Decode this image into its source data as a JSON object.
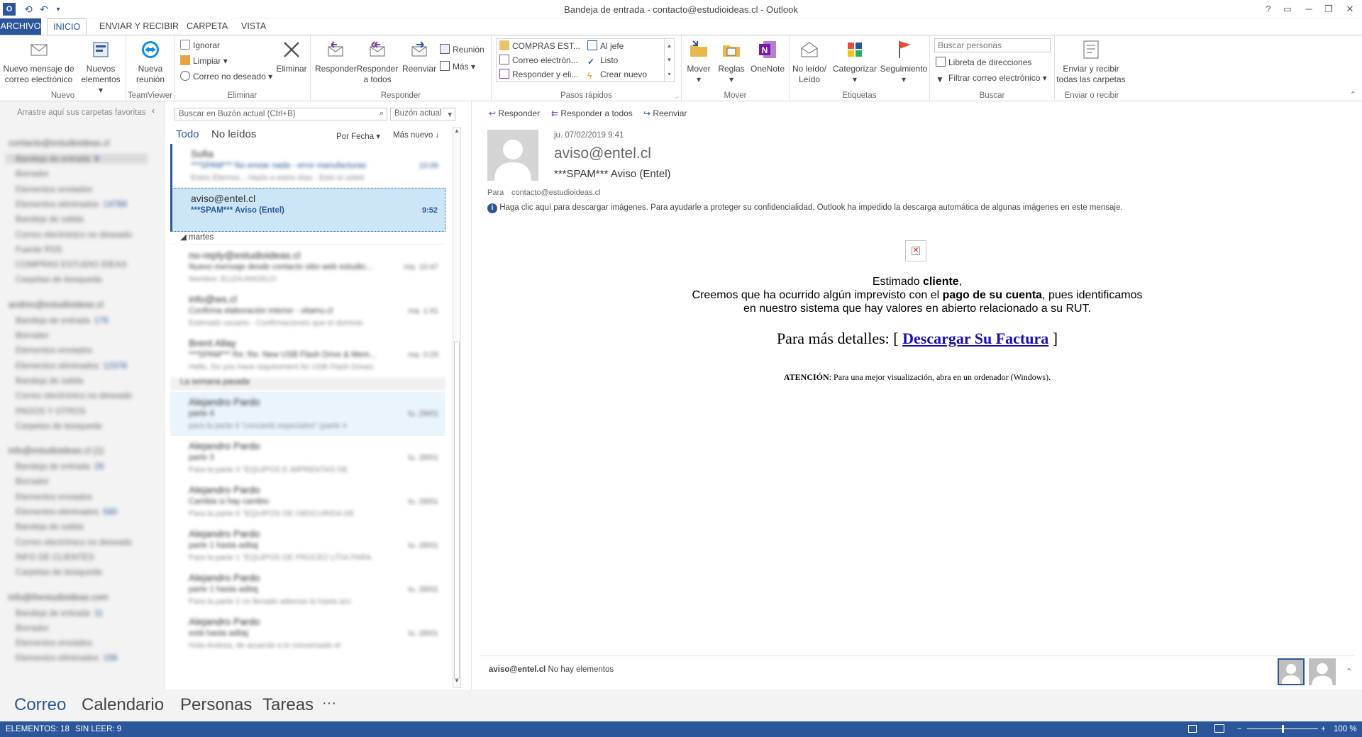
{
  "window": {
    "title": "Bandeja de entrada - contacto@estudioideas.cl - Outlook",
    "help": "?",
    "restore": "▭",
    "minimize": "─",
    "maximize": "❐",
    "close": "✕"
  },
  "ribbon_tabs": [
    "ARCHIVO",
    "INICIO",
    "ENVIAR Y RECIBIR",
    "CARPETA",
    "VISTA"
  ],
  "ribbon": {
    "nuevo": {
      "group": "Nuevo",
      "new_mail_1": "Nuevo mensaje de",
      "new_mail_2": "correo electrónico",
      "new_items_1": "Nuevos",
      "new_items_2": "elementos"
    },
    "teamviewer": {
      "group": "TeamViewer",
      "meeting_1": "Nueva",
      "meeting_2": "reunión"
    },
    "eliminar": {
      "group": "Eliminar",
      "ignore": "Ignorar",
      "clean": "Limpiar",
      "junk": "Correo no deseado",
      "delete": "Eliminar"
    },
    "responder": {
      "group": "Responder",
      "reply": "Responder",
      "reply_all_1": "Responder",
      "reply_all_2": "a todos",
      "forward": "Reenviar",
      "meeting": "Reunión",
      "more": "Más"
    },
    "pasos": {
      "group": "Pasos rápidos",
      "items": [
        "COMPRAS EST...",
        "Correo electrón...",
        "Responder y eli...",
        "Al jefe",
        "Listo",
        "Crear nuevo"
      ]
    },
    "mover": {
      "group": "Mover",
      "move": "Mover",
      "rules": "Reglas",
      "onenote": "OneNote"
    },
    "etiquetas": {
      "group": "Etiquetas",
      "unread_1": "No leído/",
      "unread_2": "Leído",
      "categorize": "Categorizar",
      "followup": "Seguimiento"
    },
    "buscar": {
      "group": "Buscar",
      "people_placeholder": "Buscar personas",
      "address_book": "Libreta de direcciones",
      "filter": "Filtrar correo electrónico"
    },
    "enviar": {
      "group": "Enviar o recibir",
      "sendall_1": "Enviar y recibir",
      "sendall_2": "todas las carpetas"
    }
  },
  "folders": {
    "favorites_hint": "Arrastre aquí sus carpetas favoritas",
    "accounts": [
      {
        "name": "contacto@estudioideas.cl",
        "items": [
          {
            "n": "Bandeja de entrada",
            "c": "9"
          },
          {
            "n": "Borrador",
            "c": ""
          },
          {
            "n": "Elementos enviados",
            "c": ""
          },
          {
            "n": "Elementos eliminados",
            "c": "14789"
          },
          {
            "n": "Bandeja de salida",
            "c": ""
          },
          {
            "n": "Correo electrónico no deseado",
            "c": ""
          },
          {
            "n": "Fuente RSS",
            "c": ""
          },
          {
            "n": "COMPRAS ESTUDIO IDEAS",
            "c": ""
          },
          {
            "n": "Carpetas de búsqueda",
            "c": ""
          }
        ]
      },
      {
        "name": "andres@estudioideas.cl",
        "items": [
          {
            "n": "Bandeja de entrada",
            "c": "176"
          },
          {
            "n": "Borrador",
            "c": ""
          },
          {
            "n": "Elementos enviados",
            "c": ""
          },
          {
            "n": "Elementos eliminados",
            "c": "12378"
          },
          {
            "n": "Bandeja de salida",
            "c": ""
          },
          {
            "n": "Correo electrónico no deseado",
            "c": ""
          },
          {
            "n": "PAGOS Y OTROS",
            "c": ""
          },
          {
            "n": "Carpetas de búsqueda",
            "c": ""
          }
        ]
      },
      {
        "name": "info@estudioideas.cl (1)",
        "items": [
          {
            "n": "Bandeja de entrada",
            "c": "29"
          },
          {
            "n": "Borrador",
            "c": ""
          },
          {
            "n": "Elementos enviados",
            "c": ""
          },
          {
            "n": "Elementos eliminados",
            "c": "580"
          },
          {
            "n": "Bandeja de salida",
            "c": ""
          },
          {
            "n": "Correo electrónico no deseado",
            "c": ""
          },
          {
            "n": "INFO DE CLIENTES",
            "c": ""
          },
          {
            "n": "Carpetas de búsqueda",
            "c": ""
          }
        ]
      },
      {
        "name": "info@thestudioideas.com",
        "items": [
          {
            "n": "Bandeja de entrada",
            "c": "11"
          },
          {
            "n": "Borrador",
            "c": ""
          },
          {
            "n": "Elementos enviados",
            "c": ""
          },
          {
            "n": "Elementos eliminados",
            "c": "158"
          }
        ]
      }
    ]
  },
  "list": {
    "search_placeholder": "Buscar en Buzón actual (Ctrl+B)",
    "scope": "Buzón actual",
    "filter_all": "Todo",
    "filter_unread": "No leídos",
    "sort": "Por Fecha",
    "order": "Más nuevo",
    "group_tuesday": "martes",
    "group_lastweek": "La semana pasada",
    "messages": [
      {
        "from": "Sofia",
        "subject": "***SPAM*** No enviar nada - error manufacturas",
        "preview": "Estos Eternos... Hazlo a estos días - Esto si usted",
        "time": "10:06"
      },
      {
        "from": "aviso@entel.cl",
        "subject": "***SPAM***  Aviso (Entel)",
        "preview": "",
        "time": "9:52"
      },
      {
        "from": "no-reply@estudioideas.cl",
        "subject": "Nuevo mensaje desde contacto sitio web estudio...",
        "preview": "Nombre: ELIZA ANGELO",
        "time": "ma. 10:47"
      },
      {
        "from": "info@ws.cl",
        "subject": "Confirma elaboración interior - vitamu.cl",
        "preview": "Estimado usuario - Confirmaciones que el dominio",
        "time": "ma. 1:41"
      },
      {
        "from": "Brent Allay",
        "subject": "***SPAM*** Re: Re: New USB Flash Drive & Mem...",
        "preview": "Hello, Do you have requirement for USB Flash Drives",
        "time": "ma. 0:29"
      },
      {
        "from": "Alejandro Pardo",
        "subject": "parte 4",
        "preview": "para la parte 4 \"concierto especiales\" (parte 4",
        "time": "lu. 29/01"
      },
      {
        "from": "Alejandro Pardo",
        "subject": "parte 3",
        "preview": "Para la parte 3 \"EQUIPOS E IMPRENTAS DE",
        "time": "lu. 28/01"
      },
      {
        "from": "Alejandro Pardo",
        "subject": "Cambia si hay cambio",
        "preview": "Para la parte 6 \"EQUIPOS DE OBSCURIDA DE",
        "time": "lu. 28/01"
      },
      {
        "from": "Alejandro Pardo",
        "subject": "parte 1 hasta aditaj",
        "preview": "Para la parte 1 \"EQUIPOS DE PROCEZ LÍTIA PARA",
        "time": "lu. 28/01"
      },
      {
        "from": "Alejandro Pardo",
        "subject": "parte 1 hasta aditaj",
        "preview": "Para la parte 2 co llenado ademas la hasta acc",
        "time": "lu. 28/01"
      },
      {
        "from": "Alejandro Pardo",
        "subject": "está hasta aditaj",
        "preview": "Hola Andrea, de acuerdo a lo conversado el",
        "time": "lu. 28/01"
      }
    ]
  },
  "reading": {
    "reply": "Responder",
    "reply_all": "Responder a todos",
    "forward": "Reenviar",
    "date": "ju. 07/02/2019 9:41",
    "from": "aviso@entel.cl",
    "subject": "***SPAM***  Aviso (Entel)",
    "to_label": "Para",
    "to": "contacto@estudioideas.cl",
    "info": "Haga clic aquí para descargar imágenes. Para ayudarle a proteger su confidencialidad, Outlook ha impedido la descarga automática de algunas imágenes en este mensaje.",
    "body_greeting_1": "Estimado ",
    "body_greeting_bold": "cliente",
    "body_greeting_2": ",",
    "body_line2_a": "Creemos que ha ocurrido algún imprevisto con el ",
    "body_line2_b": "pago de su cuenta",
    "body_line2_c": ", pues identificamos",
    "body_line3": "en nuestro sistema que hay valores en abierto relacionado a su RUT.",
    "details_a": "Para más detalles: [ ",
    "details_link": "Descargar Su Factura",
    "details_b": " ]",
    "attention_bold": "ATENCIÓN",
    "attention_rest": ": Para una mejor visualización, abra en un ordenador (Windows).",
    "people_name": "aviso@entel.cl",
    "people_status": "No hay elementos"
  },
  "nav": [
    "Correo",
    "Calendario",
    "Personas",
    "Tareas",
    "···"
  ],
  "status": {
    "items": "ELEMENTOS: 18",
    "unread": "SIN LEER: 9",
    "zoom": "100 %",
    "zoom_level": 0.5
  },
  "colors": {
    "accent": "#2b579a",
    "selected": "#cde6f7",
    "link": "#1a0dab"
  }
}
